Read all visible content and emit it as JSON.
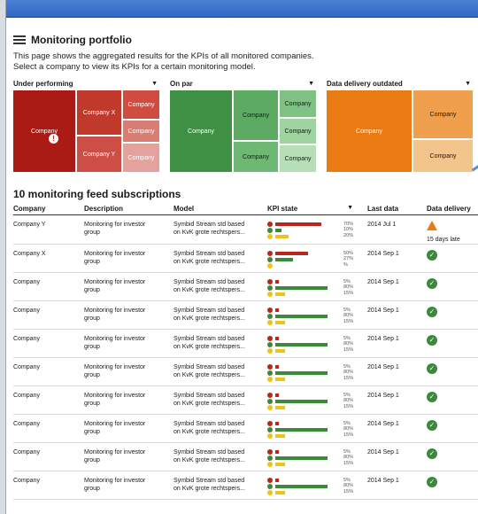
{
  "page": {
    "title": "Monitoring portfolio",
    "intro_line1": "This page shows the aggregated results for the KPIs of all monitored companies.",
    "intro_line2": "Select a company to view its KPIs for a certain monitoring model."
  },
  "boards": [
    {
      "label": "Under performing",
      "tiles": [
        "Company",
        "Company X",
        "Company",
        "Company",
        "Company Y",
        "Company"
      ]
    },
    {
      "label": "On par",
      "tiles": [
        "Company",
        "Company",
        "Company",
        "Company",
        "Company",
        "Company"
      ]
    },
    {
      "label": "Data delivery outdated",
      "tiles": [
        "Company",
        "Company",
        "Company"
      ]
    }
  ],
  "subscriptions": {
    "title": "10 monitoring feed subscriptions",
    "columns": [
      "Company",
      "Description",
      "Model",
      "KPI state",
      "Last data",
      "Data delivery"
    ],
    "rows": [
      {
        "company": "Company Y",
        "desc1": "Monitoring for investor",
        "desc2": "group",
        "model1": "Symbid Stream std based",
        "model2": "on KvK grote rechtspers...",
        "kpi": [
          0.7,
          0.1,
          0.2
        ],
        "pcts": [
          "70%",
          "10%",
          "20%"
        ],
        "last": "2014 Jul 1",
        "status": "warning",
        "late": "15 days late"
      },
      {
        "company": "Company X",
        "desc1": "Monitoring for investor",
        "desc2": "group",
        "model1": "Symbid Stream std based",
        "model2": "on KvK grote rechtspers...",
        "kpi": [
          0.5,
          0.27,
          0.0
        ],
        "pcts": [
          "50%",
          "27%",
          "%"
        ],
        "last": "2014 Sep 1",
        "status": "ok",
        "late": ""
      },
      {
        "company": "Company",
        "desc1": "Monitoring for investor",
        "desc2": "group",
        "model1": "Symbid Stream std based",
        "model2": "on KvK grote rechtspers...",
        "kpi": [
          0.05,
          0.8,
          0.15
        ],
        "pcts": [
          "5%",
          "80%",
          "15%"
        ],
        "last": "2014 Sep 1",
        "status": "ok",
        "late": ""
      },
      {
        "company": "Company",
        "desc1": "Monitoring for investor",
        "desc2": "group",
        "model1": "Symbid Stream std based",
        "model2": "on KvK grote rechtspers...",
        "kpi": [
          0.05,
          0.8,
          0.15
        ],
        "pcts": [
          "5%",
          "80%",
          "15%"
        ],
        "last": "2014 Sep 1",
        "status": "ok",
        "late": ""
      },
      {
        "company": "Company",
        "desc1": "Monitoring for investor",
        "desc2": "group",
        "model1": "Symbid Stream std based",
        "model2": "on KvK grote rechtspers...",
        "kpi": [
          0.05,
          0.8,
          0.15
        ],
        "pcts": [
          "5%",
          "80%",
          "15%"
        ],
        "last": "2014 Sep 1",
        "status": "ok",
        "late": ""
      },
      {
        "company": "Company",
        "desc1": "Monitoring for investor",
        "desc2": "group",
        "model1": "Symbid Stream std based",
        "model2": "on KvK grote rechtspers...",
        "kpi": [
          0.05,
          0.8,
          0.15
        ],
        "pcts": [
          "5%",
          "80%",
          "15%"
        ],
        "last": "2014 Sep 1",
        "status": "ok",
        "late": ""
      },
      {
        "company": "Company",
        "desc1": "Monitoring for investor",
        "desc2": "group",
        "model1": "Symbid Stream std based",
        "model2": "on KvK grote rechtspers...",
        "kpi": [
          0.05,
          0.8,
          0.15
        ],
        "pcts": [
          "5%",
          "80%",
          "15%"
        ],
        "last": "2014 Sep 1",
        "status": "ok",
        "late": ""
      },
      {
        "company": "Company",
        "desc1": "Monitoring for investor",
        "desc2": "group",
        "model1": "Symbid Stream std based",
        "model2": "on KvK grote rechtspers...",
        "kpi": [
          0.05,
          0.8,
          0.15
        ],
        "pcts": [
          "5%",
          "80%",
          "15%"
        ],
        "last": "2014 Sep 1",
        "status": "ok",
        "late": ""
      },
      {
        "company": "Company",
        "desc1": "Monitoring for investor",
        "desc2": "group",
        "model1": "Symbid Stream std based",
        "model2": "on KvK grote rechtspers...",
        "kpi": [
          0.05,
          0.8,
          0.15
        ],
        "pcts": [
          "5%",
          "80%",
          "15%"
        ],
        "last": "2014 Sep 1",
        "status": "ok",
        "late": ""
      },
      {
        "company": "Company",
        "desc1": "Monitoring for investor",
        "desc2": "group",
        "model1": "Symbid Stream std based",
        "model2": "on KvK grote rechtspers...",
        "kpi": [
          0.05,
          0.8,
          0.15
        ],
        "pcts": [
          "5%",
          "80%",
          "15%"
        ],
        "last": "2014 Sep 1",
        "status": "ok",
        "late": ""
      }
    ]
  },
  "colors": {
    "topbar": "#2f66c2",
    "red_dark": "#a91b14",
    "red_mid": "#c0392b",
    "red_light": "#d97d74",
    "green_dark": "#3f8f45",
    "green_mid": "#5dab63",
    "green_light": "#9fd3a0",
    "orange_dark": "#ea7a12",
    "orange_mid": "#f0a04d",
    "orange_light": "#f4c48d",
    "kpi_red": "#b8261d",
    "kpi_green": "#3a8a3a",
    "kpi_yellow": "#f2c21a"
  }
}
